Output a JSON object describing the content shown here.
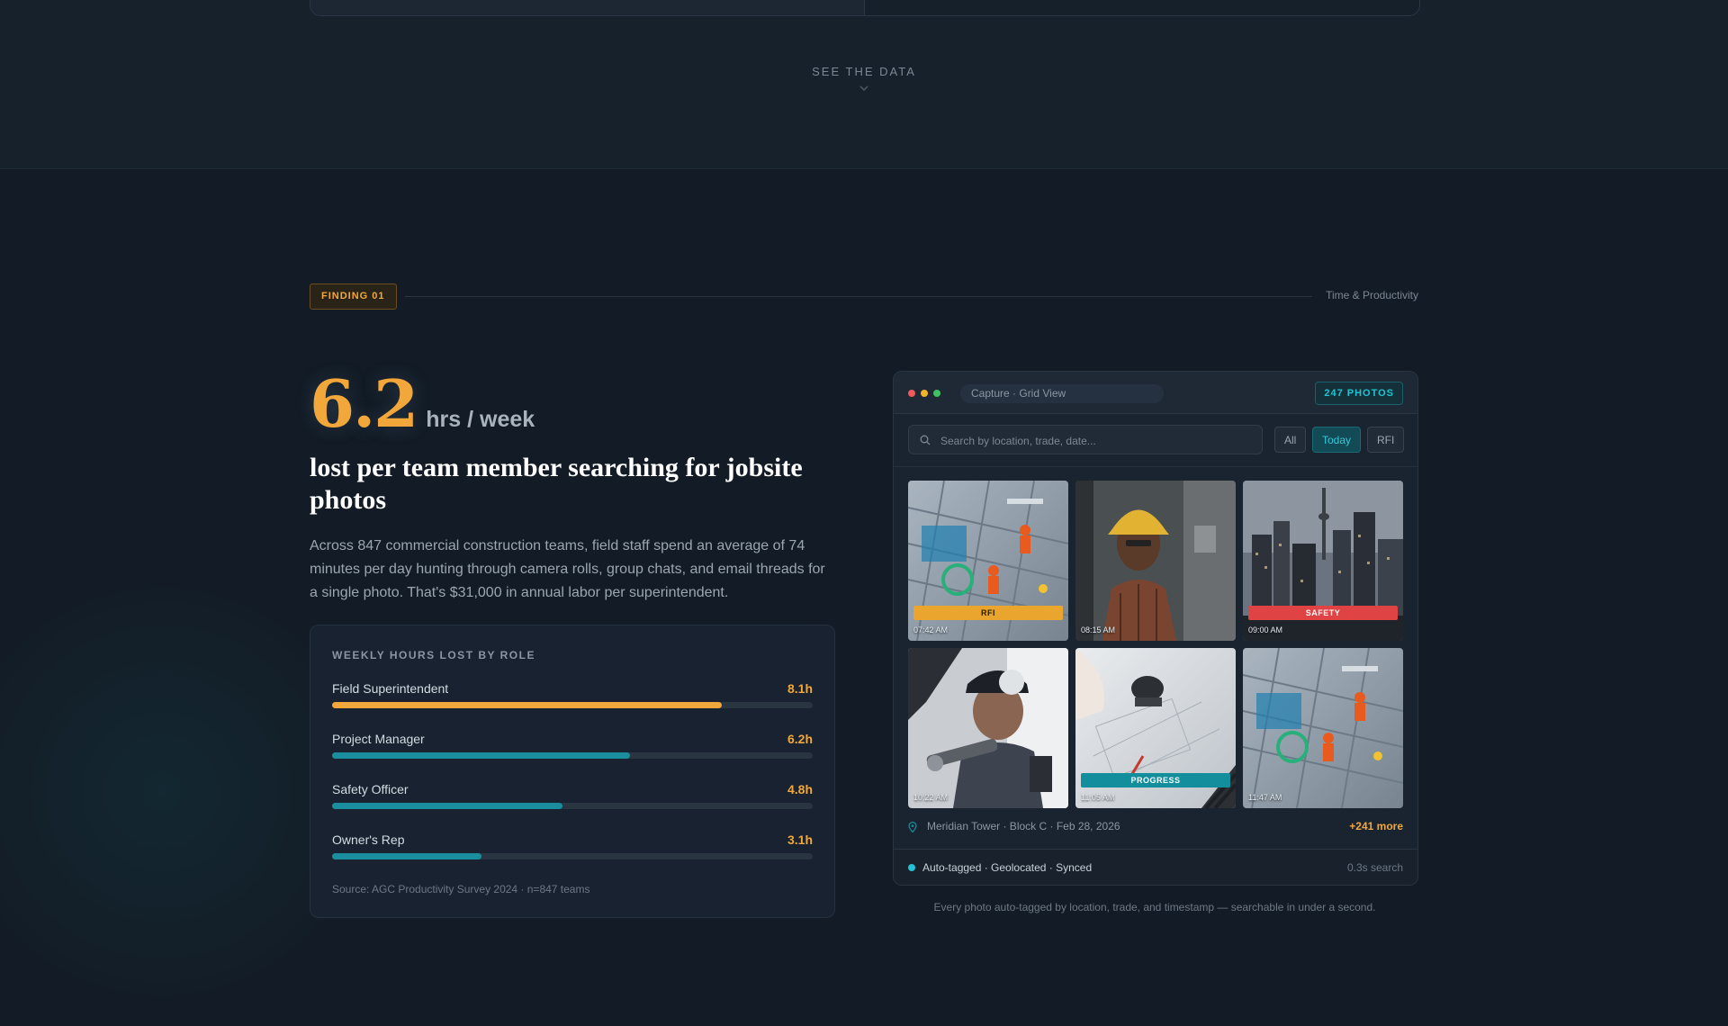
{
  "section_nav": {
    "see_data_label": "SEE THE DATA",
    "chevron_icon": "chevron-down-icon"
  },
  "finding": {
    "badge": "FINDING 01",
    "category": "Time & Productivity",
    "stat_value": "6.2",
    "stat_unit": "hrs / week",
    "headline": "lost per team member searching for jobsite photos",
    "body": "Across 847 commercial construction teams, field staff spend an average of 74 minutes per day hunting through camera rolls, group chats, and email threads for a single photo. That's $31,000 in annual labor per superintendent."
  },
  "roles_card": {
    "title": "WEEKLY HOURS LOST BY ROLE",
    "roles": [
      {
        "name": "Field Superintendent",
        "value_label": "8.1h",
        "hours": 8.1,
        "color": "#f2a73b"
      },
      {
        "name": "Project Manager",
        "value_label": "6.2h",
        "hours": 6.2,
        "color": "#1b8e9e"
      },
      {
        "name": "Safety Officer",
        "value_label": "4.8h",
        "hours": 4.8,
        "color": "#1b8e9e"
      },
      {
        "name": "Owner's Rep",
        "value_label": "3.1h",
        "hours": 3.1,
        "color": "#1b8e9e"
      }
    ],
    "max_hours": 10,
    "source": "Source: AGC Productivity Survey 2024 · n=847 teams"
  },
  "app_preview": {
    "window_title": "Capture · Grid View",
    "photo_count": "247 PHOTOS",
    "search_placeholder": "Search by location, trade, date...",
    "filters": [
      {
        "label": "All",
        "active": false
      },
      {
        "label": "Today",
        "active": true
      },
      {
        "label": "RFI",
        "active": false
      }
    ],
    "photos": [
      {
        "scene": "aerial-site",
        "time": "07:42 AM",
        "tag": "RFI",
        "tag_color": "#e9a52e"
      },
      {
        "scene": "worker-hardhat",
        "time": "08:15 AM",
        "tag": "",
        "tag_color": ""
      },
      {
        "scene": "city-skyline",
        "time": "09:00 AM",
        "tag": "SAFETY",
        "tag_color": "#e04343"
      },
      {
        "scene": "welder",
        "time": "10:22 AM",
        "tag": "",
        "tag_color": ""
      },
      {
        "scene": "blueprint-drafting",
        "time": "11:05 AM",
        "tag": "PROGRESS",
        "tag_color": "#138e9c"
      },
      {
        "scene": "aerial-site",
        "time": "11:47 AM",
        "tag": "",
        "tag_color": ""
      }
    ],
    "location": "Meridian Tower · Block C · Feb 28, 2026",
    "more": "+241 more",
    "status": "Auto-tagged · Geolocated · Synced",
    "speed": "0.3s search"
  },
  "caption": "Every photo auto-tagged by location, trade, and timestamp — searchable in under a second.",
  "colors": {
    "accent": "#f2a73b",
    "teal": "#22c3d3",
    "background": "#131c26"
  }
}
